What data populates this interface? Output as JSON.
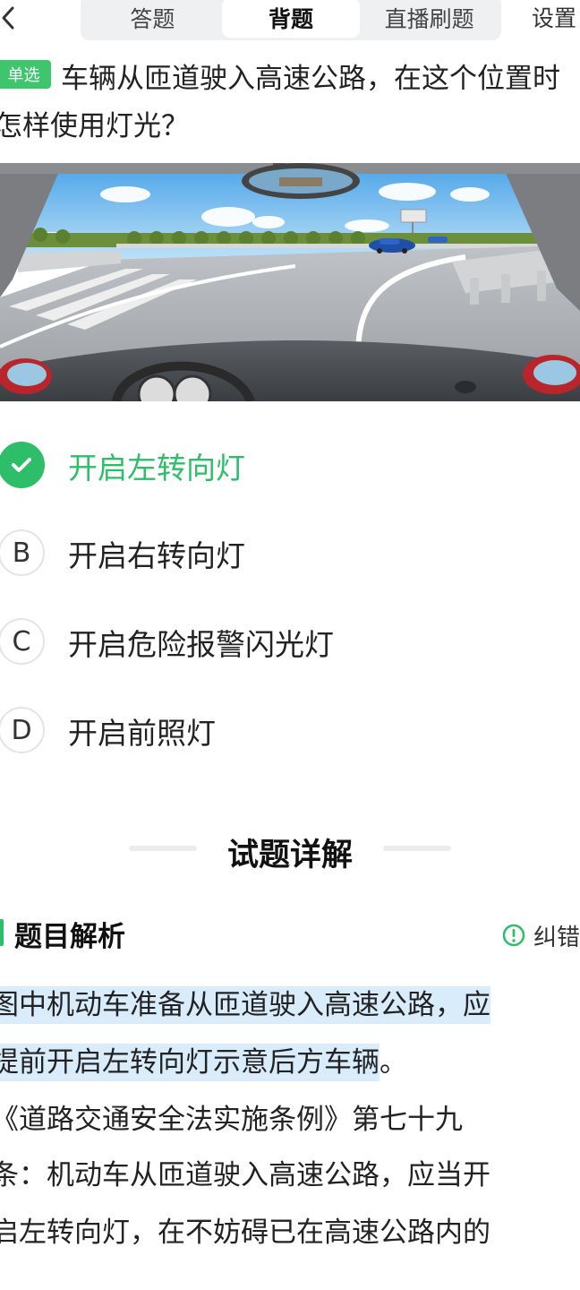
{
  "nav": {
    "tabs": [
      "答题",
      "背题",
      "直播刷题"
    ],
    "active_tab": "背题",
    "settings_label": "设置"
  },
  "question": {
    "type_badge": "单选",
    "text": "车辆从匝道驶入高速公路，在这个位置时怎样使用灯光？"
  },
  "scene": {
    "description_icon": "driver-view-highway-ramp-image"
  },
  "options": [
    {
      "letter": "A",
      "text": "开启左转向灯",
      "correct": true,
      "icon": "check-icon"
    },
    {
      "letter": "B",
      "text": "开启右转向灯",
      "correct": false
    },
    {
      "letter": "C",
      "text": "开启危险报警闪光灯",
      "correct": false
    },
    {
      "letter": "D",
      "text": "开启前照灯",
      "correct": false
    }
  ],
  "section": {
    "title": "试题详解"
  },
  "analysis": {
    "title": "题目解析",
    "report_label": "纠错",
    "lines": [
      "图中机动车准备从匝道驶入高速公路，应",
      "提前开启左转向灯示意后方车辆",
      "。",
      "《道路交通安全法实施条例》第七十九",
      "条：机动车从匝道驶入高速公路，应当开",
      "启左转向灯，在不妨碍已在高速公路内的"
    ]
  },
  "colors": {
    "accent": "#2ebd68",
    "highlight": "#d9ecfb",
    "tab_bg": "#eef0f2"
  }
}
